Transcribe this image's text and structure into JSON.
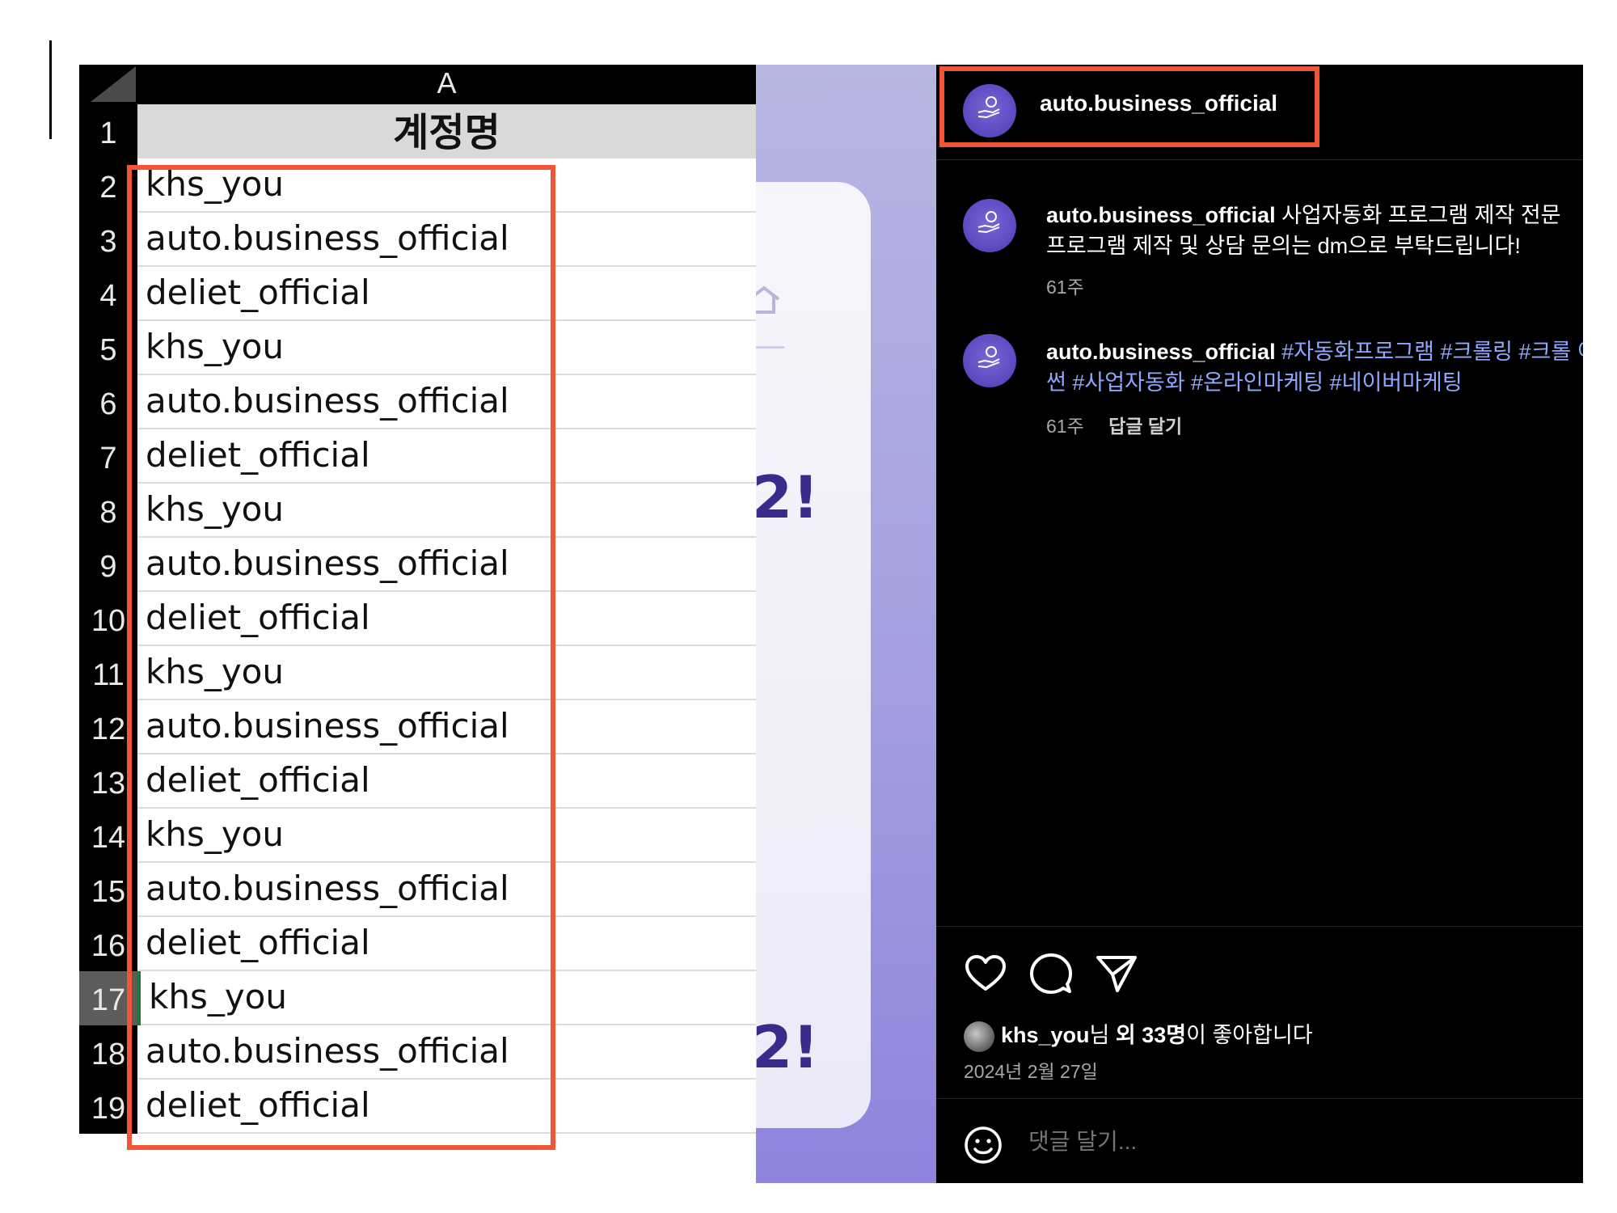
{
  "spreadsheet": {
    "column_header": "A",
    "header_row": {
      "number": "1",
      "value": "계정명"
    },
    "rows": [
      {
        "number": "2",
        "value": "khs_you"
      },
      {
        "number": "3",
        "value": "auto.business_official"
      },
      {
        "number": "4",
        "value": "deliet_official"
      },
      {
        "number": "5",
        "value": "khs_you"
      },
      {
        "number": "6",
        "value": "auto.business_official"
      },
      {
        "number": "7",
        "value": "deliet_official"
      },
      {
        "number": "8",
        "value": "khs_you"
      },
      {
        "number": "9",
        "value": "auto.business_official"
      },
      {
        "number": "10",
        "value": "deliet_official"
      },
      {
        "number": "11",
        "value": "khs_you"
      },
      {
        "number": "12",
        "value": "auto.business_official"
      },
      {
        "number": "13",
        "value": "deliet_official"
      },
      {
        "number": "14",
        "value": "khs_you"
      },
      {
        "number": "15",
        "value": "auto.business_official"
      },
      {
        "number": "16",
        "value": "deliet_official"
      },
      {
        "number": "17",
        "value": "khs_you",
        "active": true
      },
      {
        "number": "18",
        "value": "auto.business_official"
      },
      {
        "number": "19",
        "value": "deliet_official"
      }
    ],
    "highlight_color": "#f25533"
  },
  "middle_card": {
    "text_1": "2!",
    "text_2": "2!"
  },
  "instagram": {
    "header_username": "auto.business_official",
    "comments": [
      {
        "username": "auto.business_official",
        "text": "사업자동화 프로그램 제작 전문 프로그램 제작 및 상담 문의는 dm으로 부탁드립니다!",
        "time": "61주"
      },
      {
        "username": "auto.business_official",
        "tags": "#자동화프로그램 #크롤링 #크롤 이썬 #사업자동화 #온라인마케팅 #네이버마케팅",
        "time": "61주",
        "reply_label": "답글 달기"
      }
    ],
    "actions": [
      "heart-icon",
      "comment-icon",
      "share-icon"
    ],
    "likes": {
      "user": "khs_you",
      "suffix_1": "님 ",
      "others": "외 33명",
      "suffix_2": "이 좋아합니다"
    },
    "date": "2024년 2월 27일",
    "comment_placeholder": "댓글 달기...",
    "tag_color": "#8fa8ff",
    "background": "#000000"
  }
}
